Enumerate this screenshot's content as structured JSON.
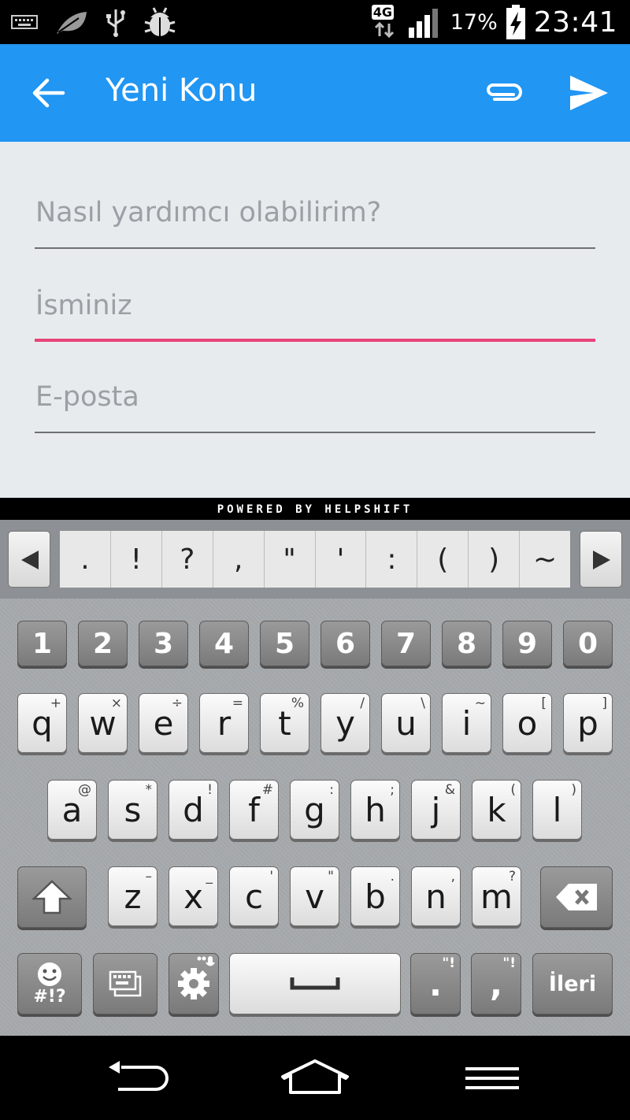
{
  "status_bar": {
    "network": "4G",
    "battery_percent": "17%",
    "time": "23:41",
    "icons": [
      "keyboard-icon",
      "leaf-icon",
      "usb-icon",
      "bug-icon",
      "signal-icon",
      "battery-charging-icon"
    ]
  },
  "app_bar": {
    "title": "Yeni Konu",
    "back_icon": "arrow-back-icon",
    "attach_icon": "paperclip-icon",
    "send_icon": "send-icon",
    "color": "#2196f3"
  },
  "form": {
    "question_placeholder": "Nasıl yardımcı olabilirim?",
    "name_placeholder": "İsminiz",
    "email_placeholder": "E-posta",
    "focus_color": "#e8457a"
  },
  "powered_by": "POWERED BY HELPSHIFT",
  "keyboard": {
    "symbols": [
      ".",
      "!",
      "?",
      ",",
      "\"",
      "'",
      ":",
      "(",
      ")",
      "~"
    ],
    "numbers": [
      "1",
      "2",
      "3",
      "4",
      "5",
      "6",
      "7",
      "8",
      "9",
      "0"
    ],
    "row1": [
      {
        "k": "q",
        "a": "+"
      },
      {
        "k": "w",
        "a": "×"
      },
      {
        "k": "e",
        "a": "÷"
      },
      {
        "k": "r",
        "a": "="
      },
      {
        "k": "t",
        "a": "%"
      },
      {
        "k": "y",
        "a": "/"
      },
      {
        "k": "u",
        "a": "\\"
      },
      {
        "k": "i",
        "a": "~"
      },
      {
        "k": "o",
        "a": "["
      },
      {
        "k": "p",
        "a": "]"
      }
    ],
    "row2": [
      {
        "k": "a",
        "a": "@"
      },
      {
        "k": "s",
        "a": "*"
      },
      {
        "k": "d",
        "a": "!"
      },
      {
        "k": "f",
        "a": "#"
      },
      {
        "k": "g",
        "a": ":"
      },
      {
        "k": "h",
        "a": ";"
      },
      {
        "k": "j",
        "a": "&"
      },
      {
        "k": "k",
        "a": "("
      },
      {
        "k": "l",
        "a": ")"
      }
    ],
    "row3": [
      {
        "k": "z",
        "a": "–"
      },
      {
        "k": "x",
        "a": "_"
      },
      {
        "k": "c",
        "a": "'"
      },
      {
        "k": "v",
        "a": "\""
      },
      {
        "k": "b",
        "a": "."
      },
      {
        "k": "n",
        "a": ","
      },
      {
        "k": "m",
        "a": "?"
      }
    ],
    "emoji_label": "#!?",
    "period_key": ".",
    "period_alt": "\"!",
    "comma_key": ",",
    "comma_alt": "\"!",
    "enter_label": "İleri"
  },
  "nav_bar": {
    "icons": [
      "back-nav-icon",
      "home-nav-icon",
      "menu-nav-icon"
    ]
  }
}
